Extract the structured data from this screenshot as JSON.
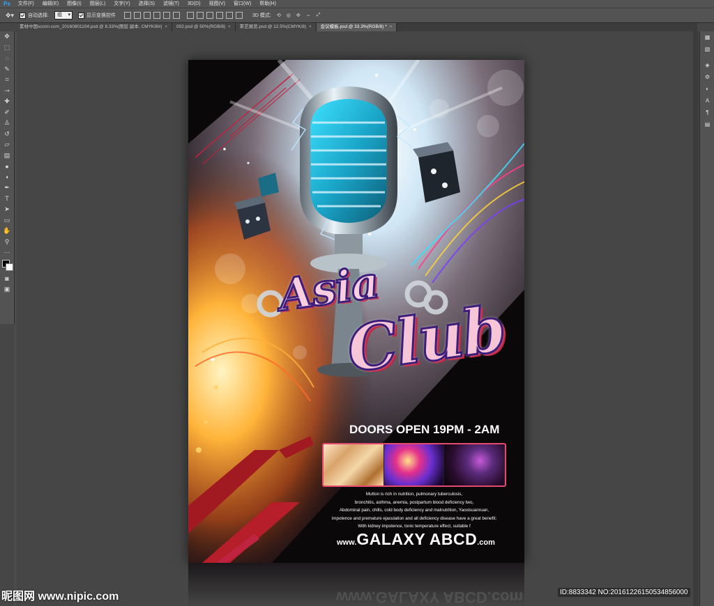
{
  "menubar": {
    "logo": "Ps",
    "items": [
      "文件(F)",
      "编辑(E)",
      "图像(I)",
      "图层(L)",
      "文字(Y)",
      "选择(S)",
      "滤镜(T)",
      "3D(D)",
      "视图(V)",
      "窗口(W)",
      "帮助(H)"
    ]
  },
  "options": {
    "auto_select_label": "自动选择:",
    "auto_select_value": "组",
    "show_transform_label": "显示变换控件",
    "mode_3d_label": "3D 模式:"
  },
  "tabs": [
    {
      "label": "素材中国sccnn.com_20160801104.psd @ 8.33%(图层 副本, CMYK/8#)"
    },
    {
      "label": "002.psd @ 50%(RGB/8)"
    },
    {
      "label": "茶艺展览.psd @ 12.5%(CMYK/8)"
    },
    {
      "label": "会议模板.psd @ 33.3%(RGB/8) *"
    }
  ],
  "poster": {
    "headline_1": "Asia",
    "headline_2": "Club",
    "doors": "DOORS OPEN 19PM - 2AM",
    "body_lines": [
      "Mutton is rich in nutrition, pulmonary tuberculosis,",
      "bronchitis, asthma, anemia, postpartum blood deficiency two,",
      "Abdominal pain, chills, cold body deficiency and malnutrition, Yaoxisuanruan,",
      "impotence and premature ejaculation and all deficiency disease have a great benefit;",
      "With kidney impotence, tonic temperature effect, suitable f"
    ],
    "website_prefix": "www.",
    "website_main": "GALAXY ABCD",
    "website_suffix": ".com"
  },
  "reflection_text": "www.GALAXY ABCD.com",
  "watermark": {
    "left": "昵图网 www.nipic.com",
    "right": "ID:8833342 NO:20161226150534856000"
  },
  "colors": {
    "workspace": "#464646",
    "panel": "#535353",
    "accent_red": "#c0233f",
    "title_stroke": "#3c1e7a"
  }
}
